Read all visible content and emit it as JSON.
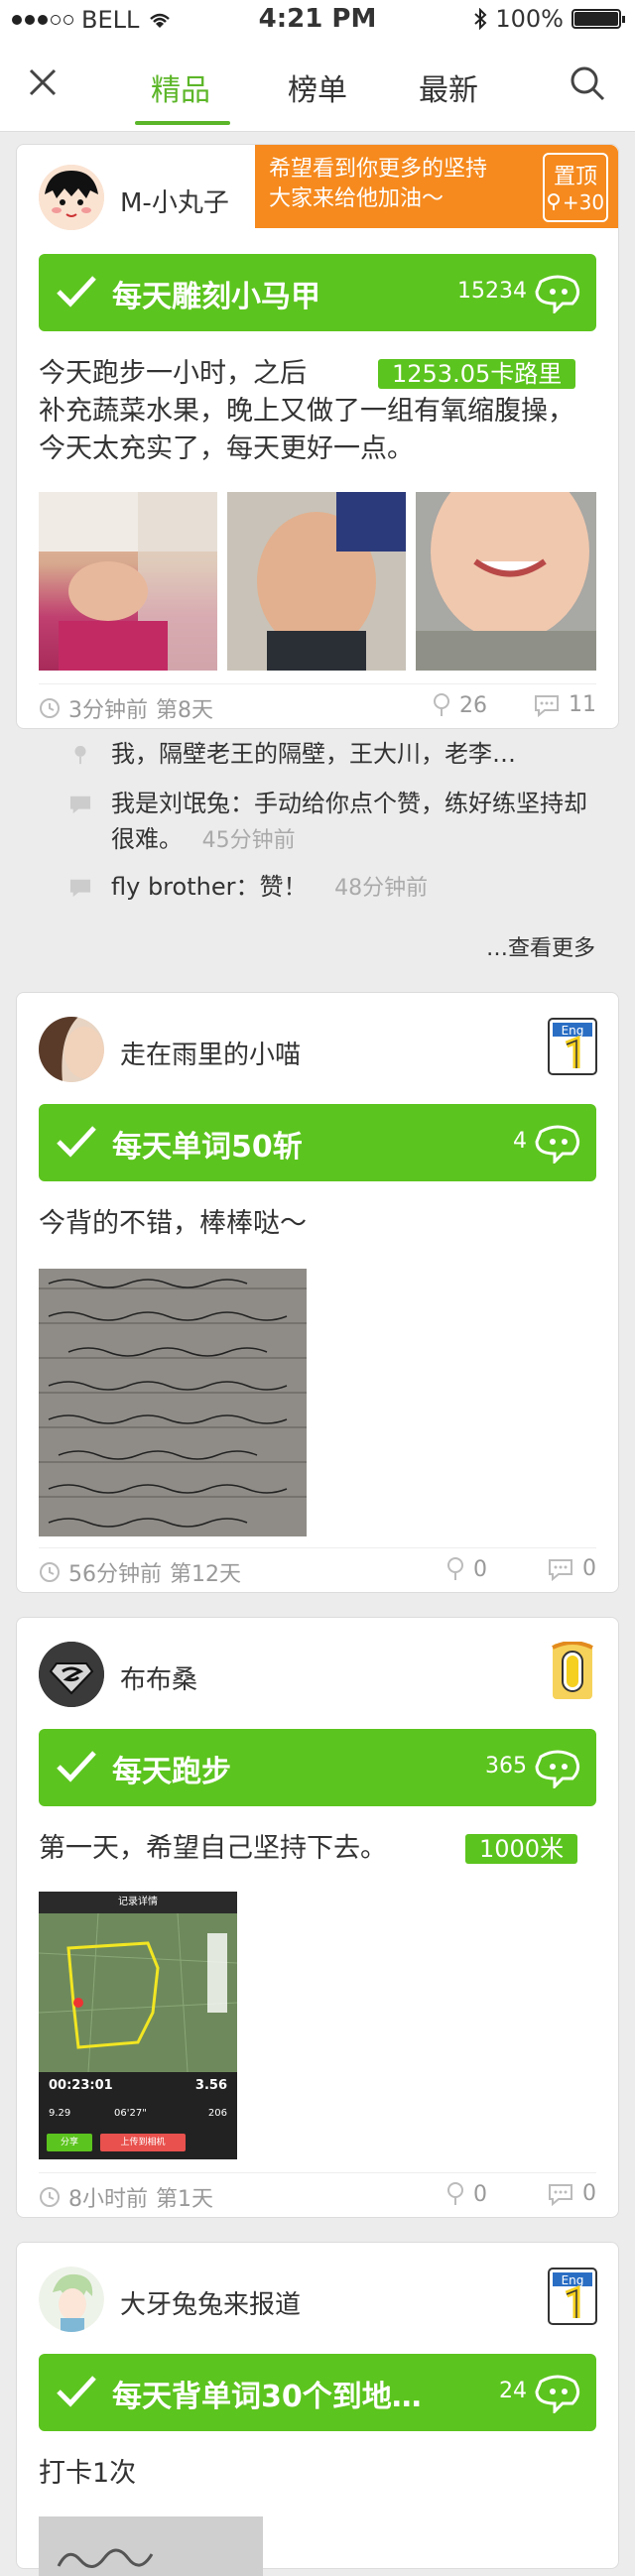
{
  "status_bar": {
    "carrier": "BELL",
    "time": "4:21 PM",
    "battery": "100%"
  },
  "nav": {
    "tabs": [
      "精品",
      "榜单",
      "最新"
    ],
    "active_tab": 0
  },
  "accent_color": "#5cc41e",
  "promo": {
    "line1": "希望看到你更多的坚持",
    "line2": "大家来给他加油～",
    "pin_label": "置顶",
    "pin_points": "+30"
  },
  "posts": [
    {
      "username": "M-小丸子",
      "goal_title": "每天雕刻小马甲",
      "goal_count": "15234",
      "text_line1": "今天跑步一小时，之后",
      "metric": "1253.05卡路里",
      "text_rest": "补充蔬菜水果，晚上又做了一组有氧缩腹操，今天太充实了，每天更好一点。",
      "time_ago": "3分钟前",
      "day": "第8天",
      "likes": "26",
      "comments": "11"
    },
    {
      "username": "走在雨里的小喵",
      "goal_title": "每天单词50斩",
      "goal_count": "4",
      "text": "今背的不错，棒棒哒～",
      "time_ago": "56分钟前",
      "day": "第12天",
      "likes": "0",
      "comments": "0"
    },
    {
      "username": "布布桑",
      "goal_title": "每天跑步",
      "goal_count": "365",
      "text": "第一天，希望自己坚持下去。",
      "metric": "1000米",
      "time_ago": "8小时前",
      "day": "第1天",
      "likes": "0",
      "comments": "0",
      "screenshot": {
        "title": "记录详情",
        "duration": "00:23:01",
        "distance": "3.56",
        "stat1": "9.29",
        "stat2": "06'27\"",
        "stat3": "206",
        "share": "分享",
        "upload": "上传到相机"
      }
    },
    {
      "username": "大牙兔兔来报道",
      "goal_title": "每天背单词30个到地…",
      "goal_count": "24",
      "text": "打卡1次"
    }
  ],
  "comment_thread": {
    "items": [
      {
        "author": "",
        "text": "我，隔壁老王的隔壁，王大川，老李…",
        "time": ""
      },
      {
        "author": "我是刘氓兔：",
        "text": "手动给你点个赞，练好练坚持却很难。",
        "time": "45分钟前"
      },
      {
        "author": "fly brother：",
        "text": "赞！",
        "time": "48分钟前"
      }
    ],
    "more_label": "…查看更多"
  },
  "badges": {
    "eng_label": "Eng"
  }
}
